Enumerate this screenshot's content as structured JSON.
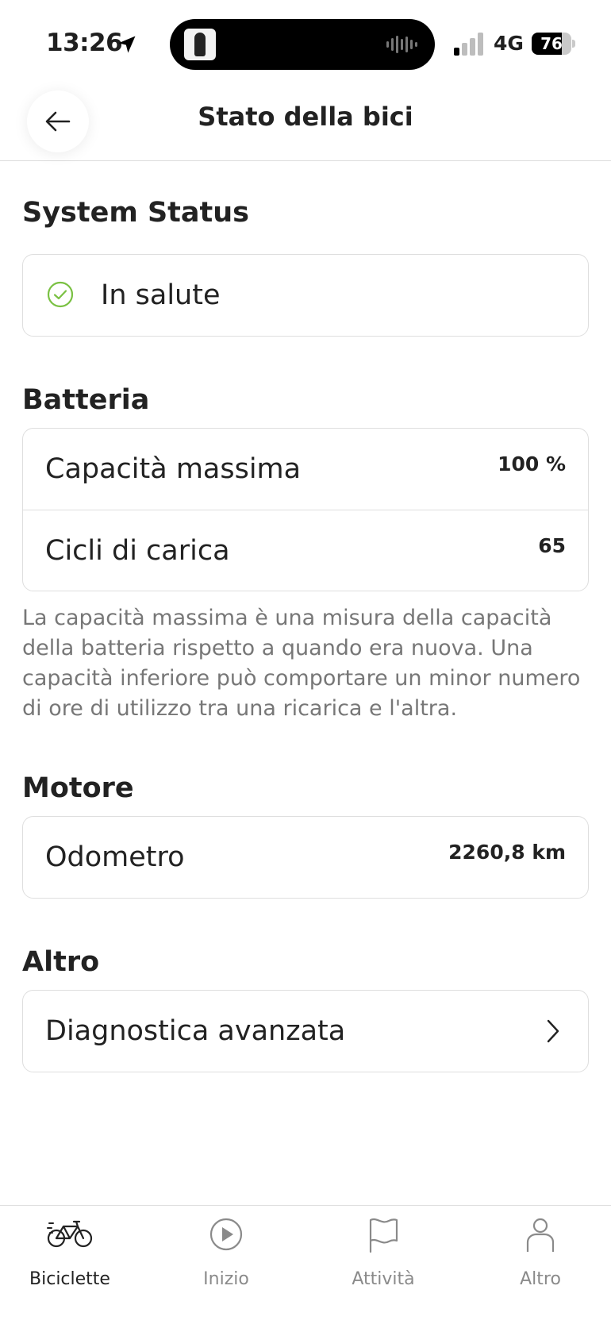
{
  "status_bar": {
    "time": "13:26",
    "network": "4G",
    "battery": "76",
    "battery_level": 0.76
  },
  "header": {
    "title": "Stato della bici",
    "back_icon": "arrow-left-icon"
  },
  "system_status": {
    "title": "System Status",
    "status_text": "In salute",
    "status_icon": "check-circle-icon",
    "status_color": "#7ac143"
  },
  "battery_section": {
    "title": "Batteria",
    "rows": [
      {
        "label": "Capacità massima",
        "value": "100 %"
      },
      {
        "label": "Cicli di carica",
        "value": "65"
      }
    ],
    "note": "La capacità massima è una misura della capacità della batteria rispetto a quando era nuova. Una capacità inferiore può comportare un minor numero di ore di utilizzo tra una ricarica e l'altra."
  },
  "motor_section": {
    "title": "Motore",
    "rows": [
      {
        "label": "Odometro",
        "value": "2260,8 km"
      }
    ]
  },
  "other_section": {
    "title": "Altro",
    "rows": [
      {
        "label": "Diagnostica avanzata",
        "icon": "chevron-right-icon"
      }
    ]
  },
  "tabbar": {
    "tabs": [
      {
        "label": "Biciclette",
        "icon": "bicycle-icon",
        "active": true
      },
      {
        "label": "Inizio",
        "icon": "play-circle-icon",
        "active": false
      },
      {
        "label": "Attività",
        "icon": "flag-icon",
        "active": false
      },
      {
        "label": "Altro",
        "icon": "person-icon",
        "active": false
      }
    ]
  }
}
